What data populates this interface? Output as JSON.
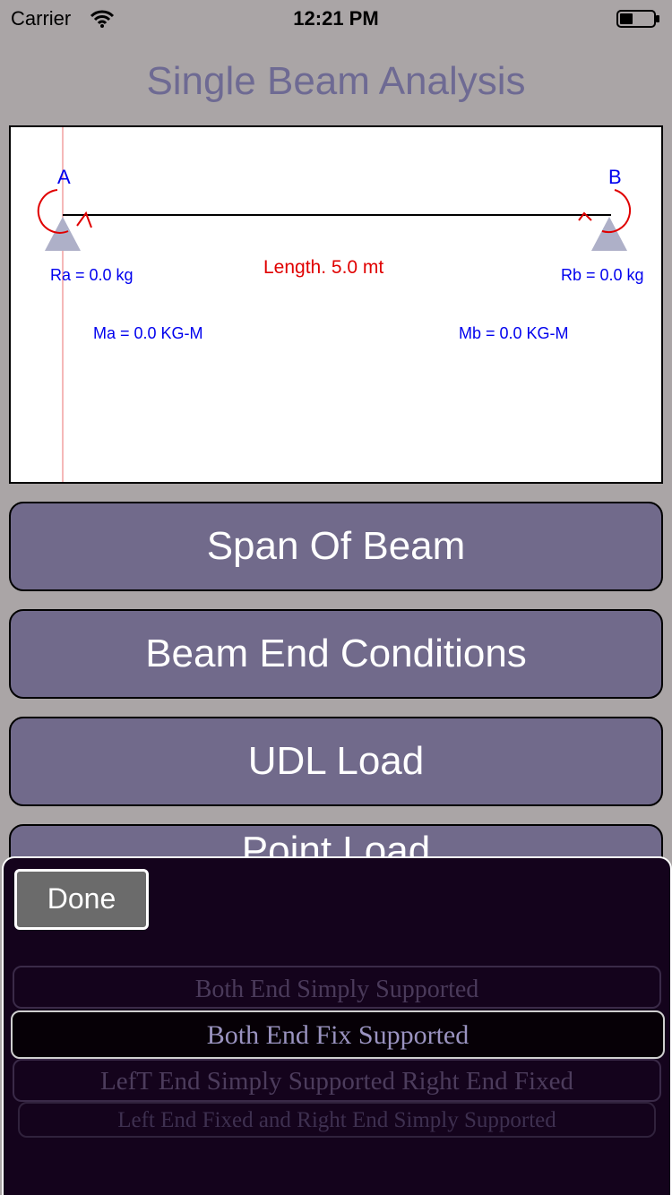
{
  "status_bar": {
    "carrier": "Carrier",
    "time": "12:21 PM"
  },
  "title": "Single Beam Analysis",
  "diagram": {
    "support_a": "A",
    "support_b": "B",
    "reaction_a": "Ra = 0.0 kg",
    "reaction_b": "Rb = 0.0 kg",
    "length": "Length. 5.0 mt",
    "moment_a": "Ma = 0.0 KG-M",
    "moment_b": "Mb = 0.0 KG-M",
    "colors": {
      "label": "#0000ee",
      "moment": "#e00000",
      "beam": "#000000",
      "support": "#aeb0c8"
    }
  },
  "buttons": {
    "span": "Span Of Beam",
    "end_conditions": "Beam End Conditions",
    "udl": "UDL Load",
    "point": "Point Load"
  },
  "picker": {
    "done": "Done",
    "options": [
      "Both End Simply Supported",
      "Both End Fix Supported",
      "LefT End Simply Supported Right End Fixed",
      "Left End Fixed and Right End Simply Supported"
    ],
    "selected": "Both End Fix Supported"
  }
}
